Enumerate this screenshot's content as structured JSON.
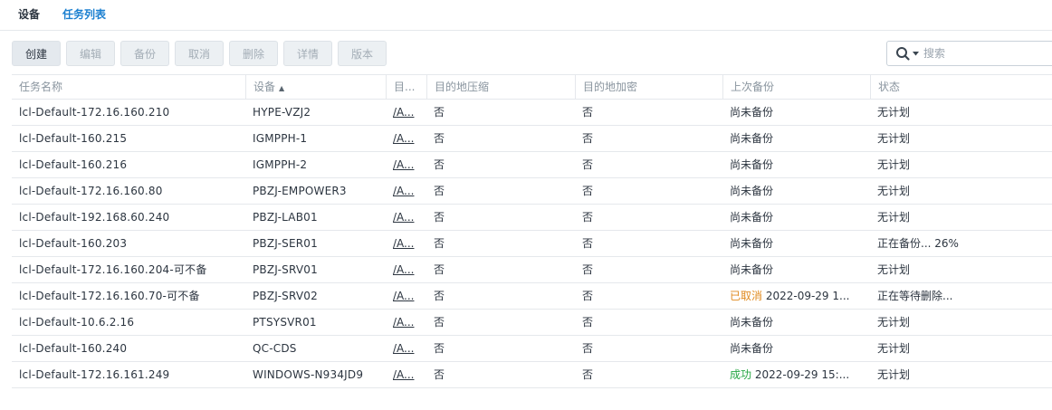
{
  "tabs": [
    {
      "label": "设备"
    },
    {
      "label": "任务列表"
    }
  ],
  "toolbar": {
    "create": "创建",
    "edit": "编辑",
    "backup": "备份",
    "cancel": "取消",
    "delete": "删除",
    "details": "详情",
    "version": "版本"
  },
  "search": {
    "placeholder": "搜索"
  },
  "columns": [
    "任务名称",
    "设备",
    "目...",
    "目的地压缩",
    "目的地加密",
    "上次备份",
    "状态"
  ],
  "sort_indicator": "▲",
  "rows": [
    {
      "name": "lcl-Default-172.16.160.210",
      "device": "HYPE-VZJ2",
      "dest": "/A...",
      "compress": "否",
      "encrypt": "否",
      "last_status": "",
      "last_text": "尚未备份",
      "status": "无计划"
    },
    {
      "name": "lcl-Default-160.215",
      "device": "IGMPPH-1",
      "dest": "/A...",
      "compress": "否",
      "encrypt": "否",
      "last_status": "",
      "last_text": "尚未备份",
      "status": "无计划"
    },
    {
      "name": "lcl-Default-160.216",
      "device": "IGMPPH-2",
      "dest": "/A...",
      "compress": "否",
      "encrypt": "否",
      "last_status": "",
      "last_text": "尚未备份",
      "status": "无计划"
    },
    {
      "name": "lcl-Default-172.16.160.80",
      "device": "PBZJ-EMPOWER3",
      "dest": "/A...",
      "compress": "否",
      "encrypt": "否",
      "last_status": "",
      "last_text": "尚未备份",
      "status": "无计划"
    },
    {
      "name": "lcl-Default-192.168.60.240",
      "device": "PBZJ-LAB01",
      "dest": "/A...",
      "compress": "否",
      "encrypt": "否",
      "last_status": "",
      "last_text": "尚未备份",
      "status": "无计划"
    },
    {
      "name": "lcl-Default-160.203",
      "device": "PBZJ-SER01",
      "dest": "/A...",
      "compress": "否",
      "encrypt": "否",
      "last_status": "",
      "last_text": "尚未备份",
      "status": "正在备份... 26%"
    },
    {
      "name": "lcl-Default-172.16.160.204-可不备",
      "device": "PBZJ-SRV01",
      "dest": "/A...",
      "compress": "否",
      "encrypt": "否",
      "last_status": "",
      "last_text": "尚未备份",
      "status": "无计划"
    },
    {
      "name": "lcl-Default-172.16.160.70-可不备",
      "device": "PBZJ-SRV02",
      "dest": "/A...",
      "compress": "否",
      "encrypt": "否",
      "last_status": "已取消",
      "last_text": " 2022-09-29 1...",
      "status": "正在等待删除..."
    },
    {
      "name": "lcl-Default-10.6.2.16",
      "device": "PTSYSVR01",
      "dest": "/A...",
      "compress": "否",
      "encrypt": "否",
      "last_status": "",
      "last_text": "尚未备份",
      "status": "无计划"
    },
    {
      "name": "lcl-Default-160.240",
      "device": "QC-CDS",
      "dest": "/A...",
      "compress": "否",
      "encrypt": "否",
      "last_status": "",
      "last_text": "尚未备份",
      "status": "无计划"
    },
    {
      "name": "lcl-Default-172.16.161.249",
      "device": "WINDOWS-N934JD9",
      "dest": "/A...",
      "compress": "否",
      "encrypt": "否",
      "last_status": "成功",
      "last_text": " 2022-09-29 15:...",
      "status": "无计划"
    }
  ],
  "colors": {
    "accent": "#1a7fd0",
    "cancelled": "#e08a1f",
    "success": "#28a745"
  }
}
